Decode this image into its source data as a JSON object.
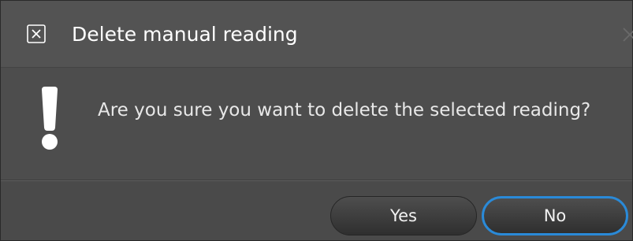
{
  "dialog": {
    "title": "Delete manual reading",
    "title_icon": "close-box-icon",
    "close_icon": "close-icon",
    "warning_icon": "exclamation-icon",
    "message": "Are you sure you want to delete the selected reading?",
    "buttons": {
      "yes_label": "Yes",
      "no_label": "No",
      "default": "No"
    },
    "colors": {
      "background": "#4e4e4e",
      "text": "#ffffff",
      "focus_ring": "#2a8ad8"
    }
  }
}
